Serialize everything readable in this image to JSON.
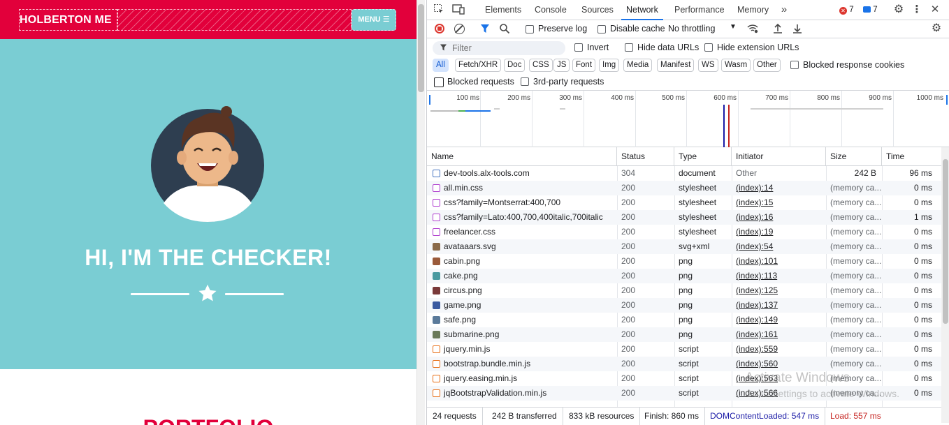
{
  "site": {
    "brand": "HOLBERTON ME",
    "menu_label": "MENU ☰",
    "hero_title": "HI, I'M THE CHECKER!",
    "next_section_title": "PORTFOLIO",
    "colors": {
      "primary": "#e2003b",
      "hero_bg": "#7acdd3"
    }
  },
  "devtools": {
    "tabs": [
      "Elements",
      "Console",
      "Sources",
      "Network",
      "Performance",
      "Memory"
    ],
    "active_tab": "Network",
    "error_count": "7",
    "message_count": "7",
    "toolbar": {
      "preserve_log": "Preserve log",
      "disable_cache": "Disable cache",
      "throttling": "No throttling"
    },
    "filter": {
      "placeholder": "Filter",
      "invert": "Invert",
      "hide_data_urls": "Hide data URLs",
      "hide_extension_urls": "Hide extension URLs",
      "types": [
        "All",
        "Fetch/XHR",
        "Doc",
        "CSS",
        "JS",
        "Font",
        "Img",
        "Media",
        "Manifest",
        "WS",
        "Wasm",
        "Other"
      ],
      "active_type": "All",
      "blocked_response_cookies": "Blocked response cookies",
      "blocked_requests": "Blocked requests",
      "third_party": "3rd-party requests"
    },
    "overview_ticks": [
      "100 ms",
      "200 ms",
      "300 ms",
      "400 ms",
      "500 ms",
      "600 ms",
      "700 ms",
      "800 ms",
      "900 ms",
      "1000 ms"
    ],
    "columns": [
      "Name",
      "Status",
      "Type",
      "Initiator",
      "Size",
      "Time"
    ],
    "requests": [
      {
        "name": "dev-tools.alx-tools.com",
        "status": "304",
        "type": "document",
        "initiator": "Other",
        "initiator_link": false,
        "size": "242 B",
        "time": "96 ms",
        "icon": "doc"
      },
      {
        "name": "all.min.css",
        "status": "200",
        "type": "stylesheet",
        "initiator": "(index):14",
        "initiator_link": true,
        "size": "(memory ca...",
        "time": "0 ms",
        "icon": "css"
      },
      {
        "name": "css?family=Montserrat:400,700",
        "status": "200",
        "type": "stylesheet",
        "initiator": "(index):15",
        "initiator_link": true,
        "size": "(memory ca...",
        "time": "0 ms",
        "icon": "css"
      },
      {
        "name": "css?family=Lato:400,700,400italic,700italic",
        "status": "200",
        "type": "stylesheet",
        "initiator": "(index):16",
        "initiator_link": true,
        "size": "(memory ca...",
        "time": "1 ms",
        "icon": "css"
      },
      {
        "name": "freelancer.css",
        "status": "200",
        "type": "stylesheet",
        "initiator": "(index):19",
        "initiator_link": true,
        "size": "(memory ca...",
        "time": "0 ms",
        "icon": "css"
      },
      {
        "name": "avataaars.svg",
        "status": "200",
        "type": "svg+xml",
        "initiator": "(index):54",
        "initiator_link": true,
        "size": "(memory ca...",
        "time": "0 ms",
        "icon": "img-avatar"
      },
      {
        "name": "cabin.png",
        "status": "200",
        "type": "png",
        "initiator": "(index):101",
        "initiator_link": true,
        "size": "(memory ca...",
        "time": "0 ms",
        "icon": "img-cabin"
      },
      {
        "name": "cake.png",
        "status": "200",
        "type": "png",
        "initiator": "(index):113",
        "initiator_link": true,
        "size": "(memory ca...",
        "time": "0 ms",
        "icon": "img-cake"
      },
      {
        "name": "circus.png",
        "status": "200",
        "type": "png",
        "initiator": "(index):125",
        "initiator_link": true,
        "size": "(memory ca...",
        "time": "0 ms",
        "icon": "img-circus"
      },
      {
        "name": "game.png",
        "status": "200",
        "type": "png",
        "initiator": "(index):137",
        "initiator_link": true,
        "size": "(memory ca...",
        "time": "0 ms",
        "icon": "img-game"
      },
      {
        "name": "safe.png",
        "status": "200",
        "type": "png",
        "initiator": "(index):149",
        "initiator_link": true,
        "size": "(memory ca...",
        "time": "0 ms",
        "icon": "img-safe"
      },
      {
        "name": "submarine.png",
        "status": "200",
        "type": "png",
        "initiator": "(index):161",
        "initiator_link": true,
        "size": "(memory ca...",
        "time": "0 ms",
        "icon": "img-submarine"
      },
      {
        "name": "jquery.min.js",
        "status": "200",
        "type": "script",
        "initiator": "(index):559",
        "initiator_link": true,
        "size": "(memory ca...",
        "time": "0 ms",
        "icon": "js"
      },
      {
        "name": "bootstrap.bundle.min.js",
        "status": "200",
        "type": "script",
        "initiator": "(index):560",
        "initiator_link": true,
        "size": "(memory ca...",
        "time": "0 ms",
        "icon": "js"
      },
      {
        "name": "jquery.easing.min.js",
        "status": "200",
        "type": "script",
        "initiator": "(index):563",
        "initiator_link": true,
        "size": "(memory ca...",
        "time": "0 ms",
        "icon": "js"
      },
      {
        "name": "jqBootstrapValidation.min.js",
        "status": "200",
        "type": "script",
        "initiator": "(index):566",
        "initiator_link": true,
        "size": "(memory ca...",
        "time": "0 ms",
        "icon": "js"
      }
    ],
    "status_bar": {
      "requests": "24 requests",
      "transferred": "242 B transferred",
      "resources": "833 kB resources",
      "finish": "Finish: 860 ms",
      "dom_content_loaded": "DOMContentLoaded: 547 ms",
      "load": "Load: 557 ms"
    },
    "colors": {
      "accent": "#1a73e8",
      "dcl": "#1a1aa6",
      "load": "#c5221f"
    }
  },
  "os_watermark": {
    "line1": "Activate Windows",
    "line2": "Go to Settings to activate Windows."
  }
}
